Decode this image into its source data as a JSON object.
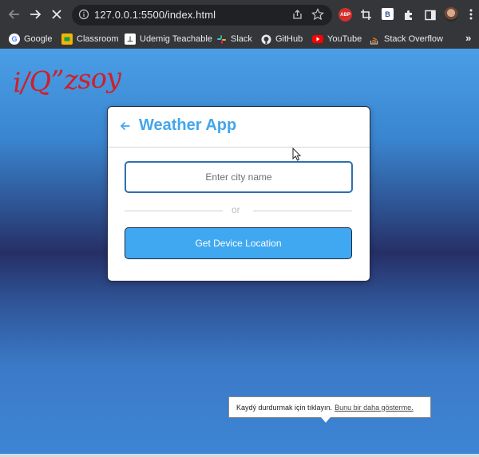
{
  "browser": {
    "url": "127.0.0.1:5500/index.html",
    "extensions": {
      "abp_label": "ABP",
      "bx_label": "B"
    },
    "bookmarks": [
      {
        "label": "Google",
        "icon": "google-icon"
      },
      {
        "label": "Classroom",
        "icon": "classroom-icon"
      },
      {
        "label": "Udemig Teachable",
        "icon": "udemy-icon"
      },
      {
        "label": "Slack",
        "icon": "slack-icon"
      },
      {
        "label": "GitHub",
        "icon": "github-icon"
      },
      {
        "label": "YouTube",
        "icon": "youtube-icon"
      },
      {
        "label": "Stack Overflow",
        "icon": "stackoverflow-icon"
      }
    ],
    "more_label": "»"
  },
  "page": {
    "logo_signature": "i/Q”zsoy",
    "card": {
      "title": "Weather App",
      "input_placeholder": "Enter city name",
      "separator": "or",
      "button_label": "Get Device Location"
    }
  },
  "tooltip": {
    "text": "Kaydý durdurmak için tıklayın.",
    "link": "Bunu bir daha gösterme."
  },
  "colors": {
    "accent": "#43a6ec",
    "button": "#3fa8f0",
    "input_border": "#2d6fb0",
    "logo": "#d01f2b",
    "chrome": "#35363a"
  }
}
